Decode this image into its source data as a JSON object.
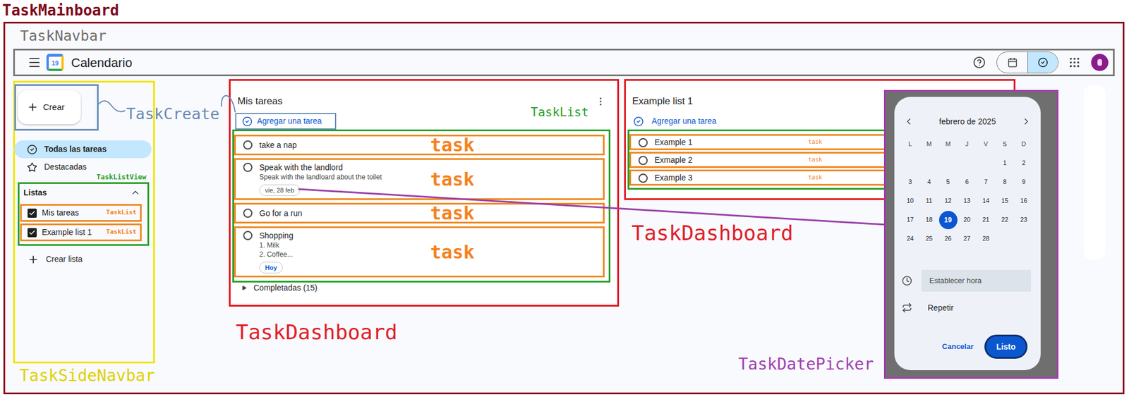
{
  "annotations": {
    "mainboard": "TaskMainboard",
    "navbar": "TaskNavbar",
    "create": "TaskCreate",
    "list_view": "TaskListView",
    "side_navbar": "TaskSideNavbar",
    "date_picker": "TaskDatePicker"
  },
  "navbar": {
    "logo_text": "19",
    "title": "Calendario",
    "views": [
      {
        "kind": "calendar",
        "selected": false
      },
      {
        "kind": "tasks",
        "selected": true
      }
    ]
  },
  "sidebar": {
    "create_button": "Crear",
    "items": [
      {
        "label": "Todas las tareas",
        "selected": true
      },
      {
        "label": "Destacadas",
        "selected": false
      }
    ],
    "lists_header": "Listas",
    "lists_expanded": true,
    "lists": [
      {
        "label": "Mis tareas",
        "checked": true,
        "tag": "TaskList"
      },
      {
        "label": "Example list 1",
        "checked": true,
        "tag": "TaskList"
      }
    ],
    "create_list": "Crear lista"
  },
  "dashboards": [
    {
      "title": "Mis tareas",
      "kind": "large",
      "tag": "TaskDashboard",
      "list_tag": "TaskList",
      "menu": true,
      "add_task": "Agregar una tarea",
      "add_task_boxed": true,
      "tasks": [
        {
          "title": "take a nap",
          "details": [],
          "done": false,
          "tag": "task"
        },
        {
          "title": "Speak with the landlord",
          "details": [
            "Speak with the landloard about the toilet"
          ],
          "date": "vie, 28 feb",
          "today": false,
          "done": false,
          "tag": "task"
        },
        {
          "title": "Go for a run",
          "details": [],
          "done": false,
          "tag": "task"
        },
        {
          "title": "Shopping",
          "details": [
            "1. Milk",
            "2. Coffee..."
          ],
          "date": "Hoy",
          "today": true,
          "done": false,
          "tag": "task"
        }
      ],
      "completed": "Completadas (15)"
    },
    {
      "title": "Example list 1",
      "kind": "small",
      "tag": "TaskDashboard",
      "menu": false,
      "add_task": "Agregar una tarea",
      "add_task_boxed": false,
      "tasks": [
        {
          "title": "Example 1",
          "details": [],
          "done": false,
          "tag": "task"
        },
        {
          "title": "Exmaple 2",
          "details": [],
          "done": false,
          "tag": "task"
        },
        {
          "title": "Example 3",
          "details": [],
          "done": false,
          "tag": "task"
        }
      ]
    }
  ],
  "date_picker": {
    "month": "febrero de 2025",
    "weekdays": [
      "L",
      "M",
      "M",
      "J",
      "V",
      "S",
      "D"
    ],
    "weeks": [
      [
        "",
        "",
        "",
        "",
        "",
        "1",
        "2"
      ],
      [
        "3",
        "4",
        "5",
        "6",
        "7",
        "8",
        "9"
      ],
      [
        "10",
        "11",
        "12",
        "13",
        "14",
        "15",
        "16"
      ],
      [
        "17",
        "18",
        "19",
        "20",
        "21",
        "22",
        "23"
      ],
      [
        "24",
        "25",
        "26",
        "27",
        "28",
        "",
        ""
      ]
    ],
    "selected_day": "19",
    "time_placeholder": "Establecer hora",
    "repeat": "Repetir",
    "cancel": "Cancelar",
    "ok": "Listo"
  }
}
